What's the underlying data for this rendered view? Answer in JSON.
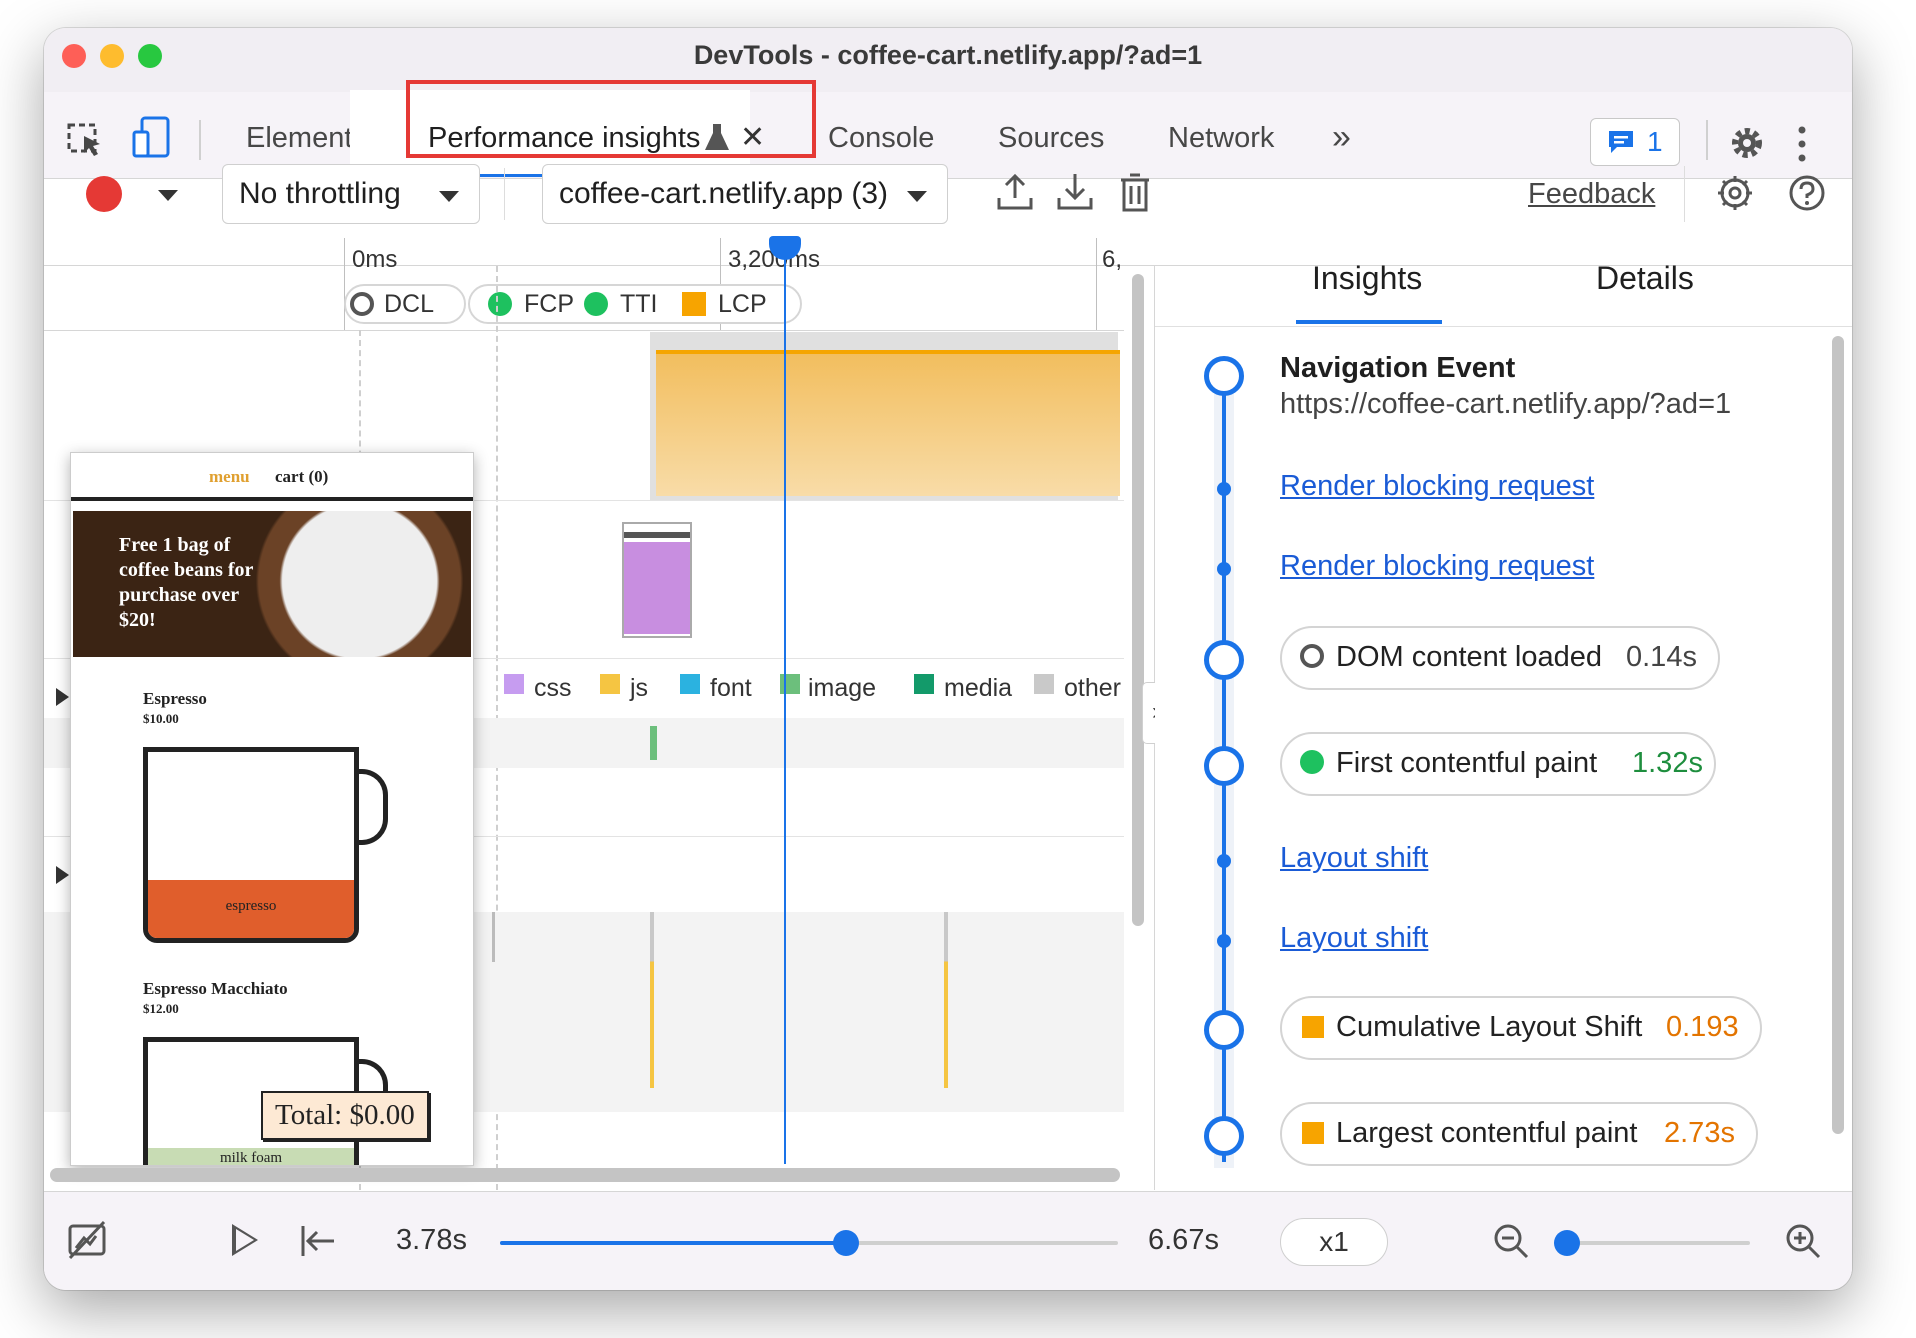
{
  "window": {
    "title": "DevTools - coffee-cart.netlify.app/?ad=1"
  },
  "tabs": [
    {
      "label": "Elements"
    },
    {
      "label": "Performance insights",
      "active": true
    },
    {
      "label": "Console"
    },
    {
      "label": "Sources"
    },
    {
      "label": "Network"
    }
  ],
  "tabbar": {
    "overflow": "»",
    "issues_count": "1"
  },
  "toolbar": {
    "throttling": "No throttling",
    "recording": "coffee-cart.netlify.app (3)",
    "feedback": "Feedback"
  },
  "timeline": {
    "ticks": [
      "0ms",
      "3,200ms",
      "6,"
    ],
    "markers": [
      "DCL",
      "FCP",
      "TTI",
      "LCP"
    ],
    "legend": [
      {
        "label": "css",
        "color": "#c69cf0"
      },
      {
        "label": "js",
        "color": "#f5c542"
      },
      {
        "label": "font",
        "color": "#2bb2e0"
      },
      {
        "label": "image",
        "color": "#6cbf7c"
      },
      {
        "label": "media",
        "color": "#139a6a"
      },
      {
        "label": "other",
        "color": "#c9c9c9"
      }
    ]
  },
  "preview": {
    "nav_menu": "menu",
    "nav_cart": "cart (0)",
    "banner": "Free 1 bag of coffee beans for purchase over $20!",
    "items": [
      {
        "name": "Espresso",
        "price": "$10.00",
        "layer": "espresso"
      },
      {
        "name": "Espresso Macchiato",
        "price": "$12.00",
        "layer": "milk foam"
      }
    ],
    "total": "Total: $0.00"
  },
  "sidebar": {
    "tabs": [
      "Insights",
      "Details"
    ],
    "nav_title": "Navigation Event",
    "nav_url": "https://coffee-cart.netlify.app/?ad=1",
    "links": [
      "Render blocking request",
      "Render blocking request",
      "Layout shift",
      "Layout shift"
    ],
    "metrics": [
      {
        "label": "DOM content loaded",
        "value": "0.14s",
        "color": "#444444"
      },
      {
        "label": "First contentful paint",
        "value": "1.32s",
        "color": "#1e8e3e"
      },
      {
        "label": "Cumulative Layout Shift",
        "value": "0.193",
        "color": "#e37400"
      },
      {
        "label": "Largest contentful paint",
        "value": "2.73s",
        "color": "#e37400"
      }
    ]
  },
  "playback": {
    "current": "3.78s",
    "end": "6.67s",
    "speed": "x1",
    "progress": 0.56,
    "zoom": 0.0
  },
  "colors": {
    "accent": "#1a73e8",
    "record": "#e53935",
    "highlight": "#e53935",
    "lcp_band": "#f2c46c"
  }
}
